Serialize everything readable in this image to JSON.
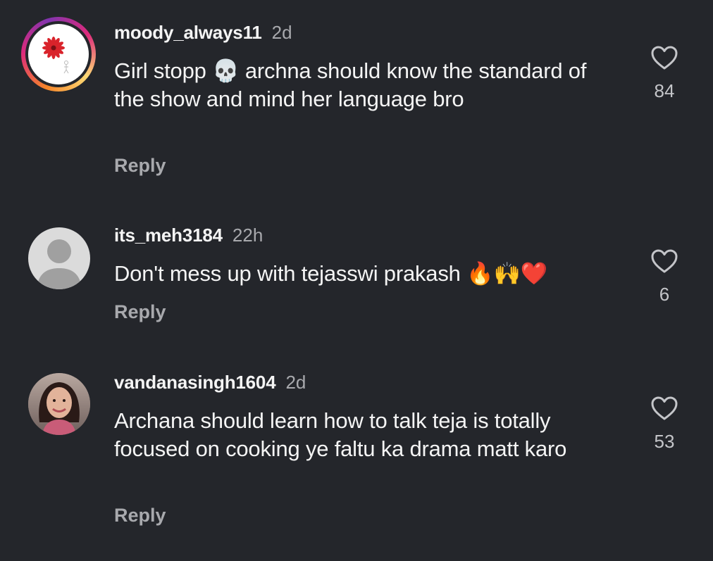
{
  "comments": [
    {
      "username": "moody_always11",
      "time": "2d",
      "text": "Girl stopp 💀 archna should know the standard of the show and mind her language bro",
      "reply_label": "Reply",
      "likes": "84",
      "avatar": "red-flower-story-avatar"
    },
    {
      "username": "its_meh3184",
      "time": "22h",
      "text": "Don't mess up with tejasswi prakash 🔥🙌❤️",
      "reply_label": "Reply",
      "likes": "6",
      "avatar": "default-person-avatar"
    },
    {
      "username": "vandanasingh1604",
      "time": "2d",
      "text": "Archana should learn how to talk teja is totally focused on cooking ye faltu ka drama matt karo",
      "reply_label": "Reply",
      "likes": "53",
      "avatar": "woman-photo-avatar"
    }
  ],
  "colors": {
    "background": "#24262b",
    "primary_text": "#f4f4f4",
    "secondary_text": "#a8a9ad",
    "icon": "#c4c5c9"
  },
  "icons": {
    "like": "heart-outline-icon"
  }
}
